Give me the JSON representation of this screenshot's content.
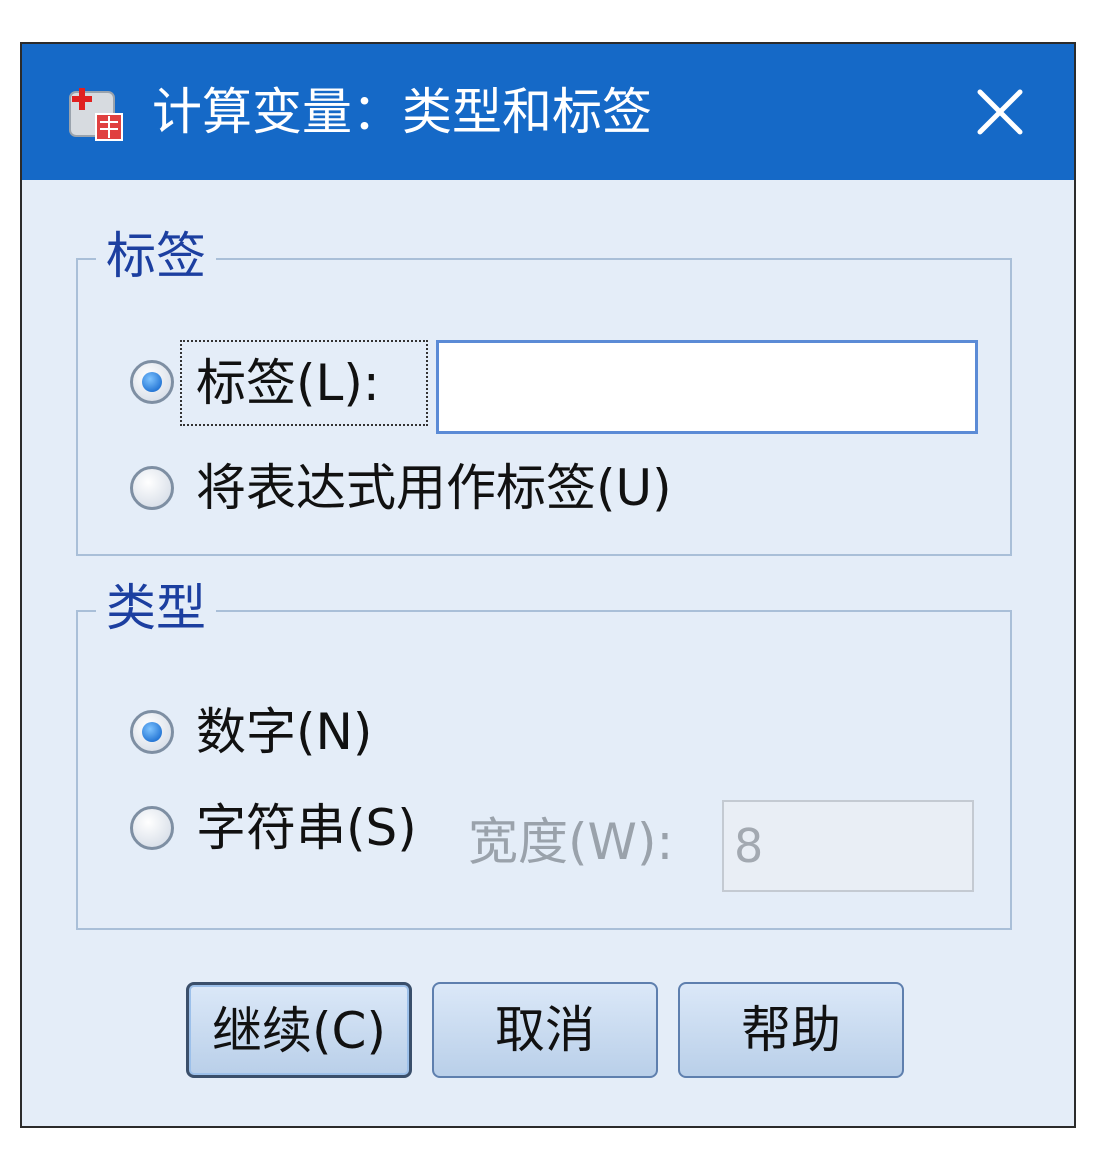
{
  "window": {
    "title": "计算变量：类型和标签",
    "close_icon": "close-icon",
    "app_icon": "compute-variable-icon"
  },
  "label_group": {
    "title": "标签",
    "label_option": "标签(L):",
    "label_option_checked": true,
    "label_value": "",
    "expression_option": "将表达式用作标签(U)",
    "expression_option_checked": false
  },
  "type_group": {
    "title": "类型",
    "numeric_option": "数字(N)",
    "numeric_option_checked": true,
    "string_option": "字符串(S)",
    "string_option_checked": false,
    "width_label": "宽度(W):",
    "width_value": "8"
  },
  "buttons": {
    "continue": "继续(C)",
    "cancel": "取消",
    "help": "帮助"
  },
  "colors": {
    "titlebar": "#1569c7",
    "dialog_bg": "#e4edf8",
    "group_label": "#1c3fa0"
  }
}
